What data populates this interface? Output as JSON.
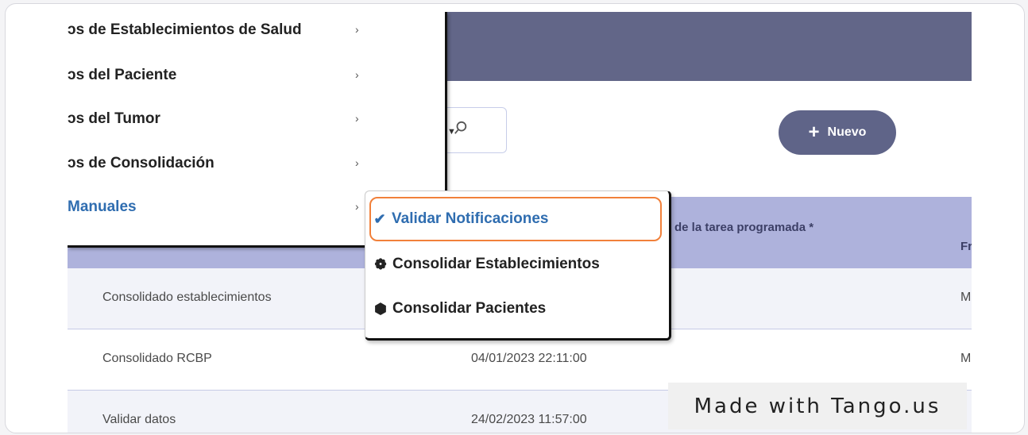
{
  "sidebar": {
    "items": [
      {
        "label": "ɔs de Establecimientos de Salud"
      },
      {
        "label": "ɔs del Paciente"
      },
      {
        "label": "ɔs del Tumor"
      },
      {
        "label": "ɔs de Consolidación"
      },
      {
        "label": "Manuales"
      }
    ],
    "chevron": "›"
  },
  "toolbar": {
    "new_label": "Nuevo"
  },
  "table": {
    "headers": [
      "de la tarea programada *",
      "Fr"
    ],
    "rows": [
      {
        "name": "Consolidado establecimientos",
        "date": "",
        "freq": "Me"
      },
      {
        "name": "Consolidado RCBP",
        "date": "04/01/2023 22:11:00",
        "freq": "Me"
      },
      {
        "name": "Validar datos",
        "date": "24/02/2023 11:57:00",
        "freq": ""
      }
    ]
  },
  "submenu": {
    "items": [
      {
        "label": "Validar Notificaciones",
        "icon": "check-icon",
        "glyph": "✔"
      },
      {
        "label": "Consolidar Establecimientos",
        "icon": "cubes-icon",
        "glyph": "❁"
      },
      {
        "label": "Consolidar Pacientes",
        "icon": "cube-icon",
        "glyph": "⬢"
      }
    ]
  },
  "watermark": "Made with Tango.us",
  "colors": {
    "header": "#626688",
    "table_header": "#aeb2dc",
    "accent_blue": "#2f6db0",
    "highlight_orange": "#f1803a"
  }
}
